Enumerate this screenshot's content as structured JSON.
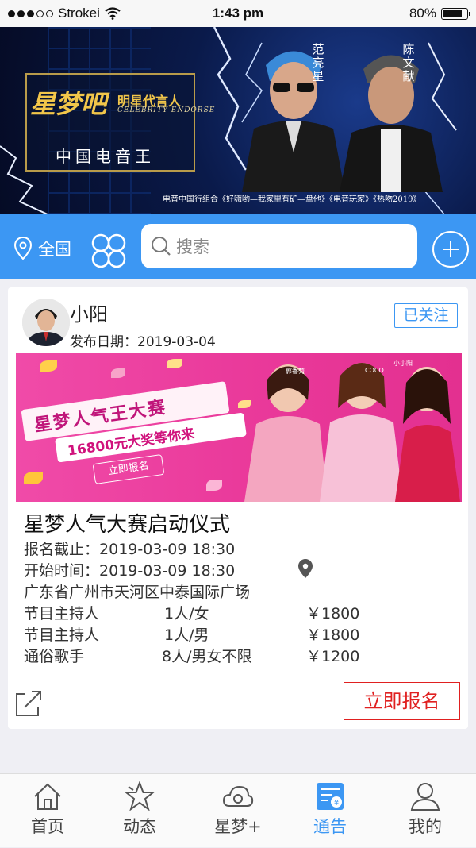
{
  "status_bar": {
    "carrier": "Strokei",
    "time": "1:43 pm",
    "battery": "80%"
  },
  "banner": {
    "brand": "星梦吧",
    "brand_sub": "明星代言人",
    "brand_en": "CELEBRITY ENDORSE",
    "slogan": "中国电音王",
    "name_left": "范亮星",
    "name_right": "陈文献",
    "caption": "电音中国行组合《好嗨哟—我家里有矿—盘他》《电音玩家》《热吻2019》"
  },
  "search_bar": {
    "location": "全国",
    "placeholder": "搜索"
  },
  "post": {
    "author": "小阳",
    "date_label": "发布日期：",
    "date": "2019-03-04",
    "follow_label": "已关注",
    "poster": {
      "headline": "星梦人气王大赛",
      "prize": "16800元大奖等你来",
      "button": "立即报名",
      "names": [
        "郭香菊",
        "COCO",
        "小小阳"
      ]
    },
    "title": "星梦人气大赛启动仪式",
    "deadline_label": "报名截止：",
    "deadline": "2019-03-09 18:30",
    "start_label": "开始时间：",
    "start": "2019-03-09 18:30",
    "address": "广东省广州市天河区中泰国际广场",
    "roles": [
      {
        "role": "节目主持人",
        "count": "1人/女",
        "fee": "￥1800"
      },
      {
        "role": "节目主持人",
        "count": "1人/男",
        "fee": "￥1800"
      },
      {
        "role": "通俗歌手",
        "count": "8人/男女不限",
        "fee": "￥1200"
      }
    ],
    "signup_label": "立即报名"
  },
  "tabs": [
    {
      "label": "首页",
      "icon": "home-icon"
    },
    {
      "label": "动态",
      "icon": "star-icon"
    },
    {
      "label": "星梦+",
      "icon": "cloud-icon"
    },
    {
      "label": "通告",
      "icon": "notice-icon",
      "active": true
    },
    {
      "label": "我的",
      "icon": "person-icon"
    }
  ],
  "colors": {
    "accent": "#3c97f3",
    "signup": "#e02020"
  }
}
